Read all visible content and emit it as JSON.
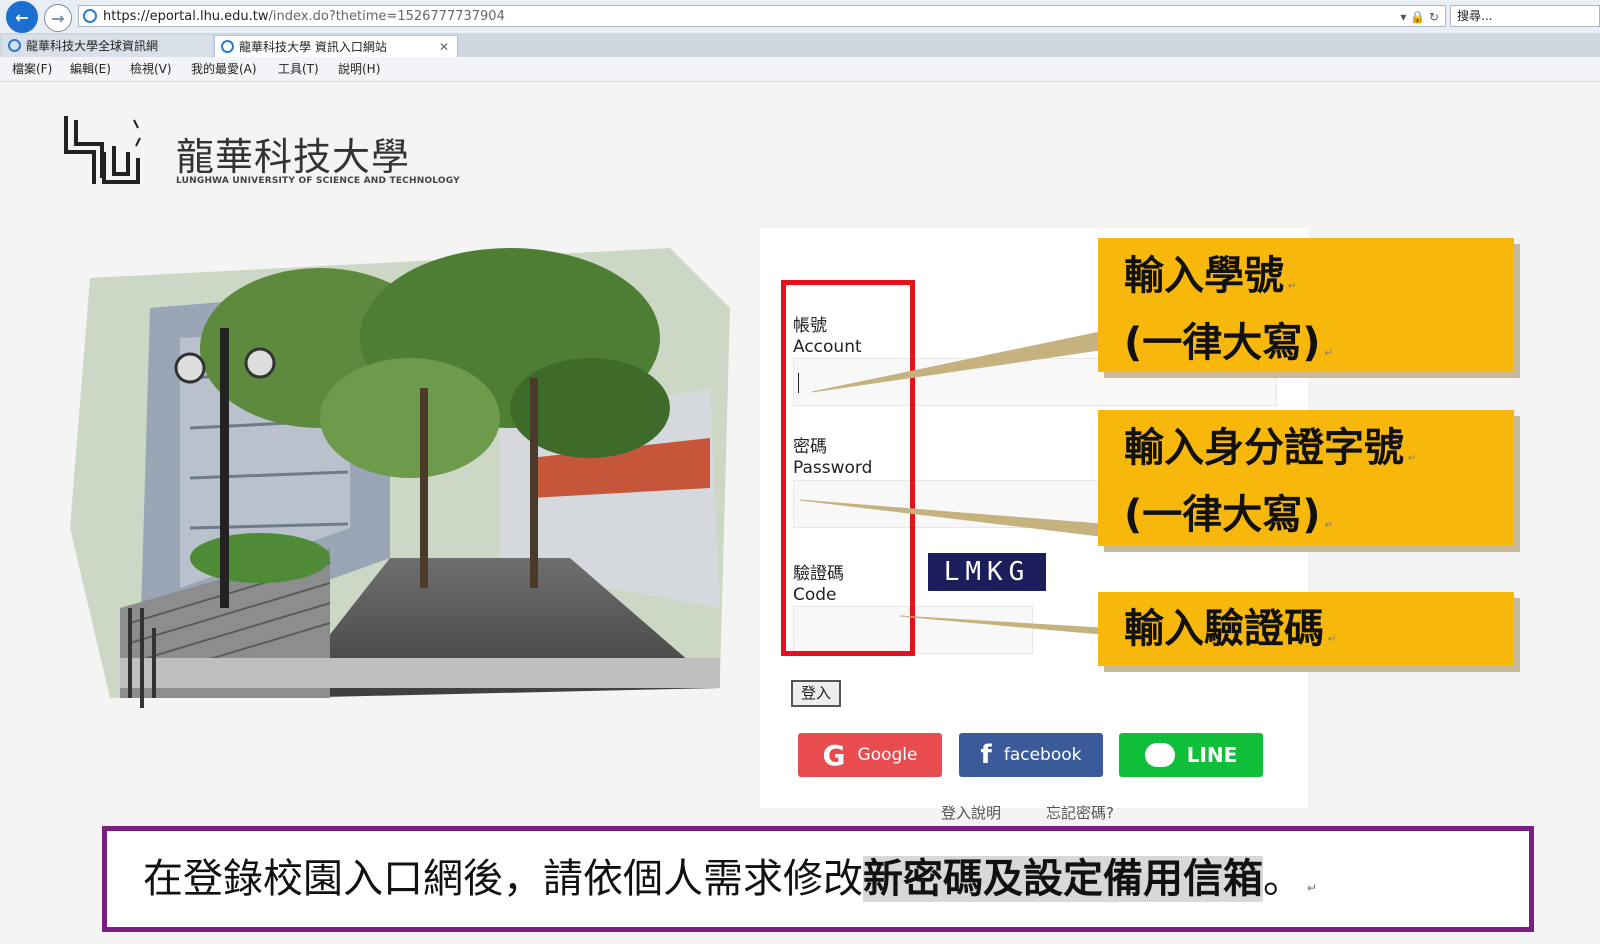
{
  "browser": {
    "url_main": "https://eportal.lhu.edu.tw",
    "url_rest": "/index.do?thetime=1526777737904",
    "search_placeholder": "搜尋...",
    "tabs": [
      {
        "label": "龍華科技大學全球資訊網",
        "active": false
      },
      {
        "label": "龍華科技大學 資訊入口網站",
        "active": true
      }
    ],
    "menu": [
      "檔案(F)",
      "編輯(E)",
      "檢視(V)",
      "我的最愛(A)",
      "工具(T)",
      "說明(H)"
    ]
  },
  "logo": {
    "cn": "龍華科技大學",
    "en": "LUNGHWA UNIVERSITY OF SCIENCE AND TECHNOLOGY"
  },
  "form": {
    "account_label_cn": "帳號",
    "account_label_en": "Account",
    "password_label_cn": "密碼",
    "password_label_en": "Password",
    "code_label_cn": "驗證碼",
    "code_label_en": "Code",
    "captcha": "LMKG",
    "login_button": "登入",
    "social": {
      "google": "Google",
      "facebook": "facebook",
      "line": "LINE"
    },
    "help_link": "登入說明",
    "forgot_link": "忘記密碼?"
  },
  "callouts": {
    "account": {
      "line1": "輸入學號",
      "line2": "(一律大寫)"
    },
    "password": {
      "line1": "輸入身分證字號",
      "line2": "(一律大寫)"
    },
    "code": {
      "line1": "輸入驗證碼"
    }
  },
  "banner": {
    "text_plain": "在登錄校園入口網後，請依個人需求修改",
    "text_highlight": "新密碼及設定備用信箱",
    "text_end": "。"
  }
}
